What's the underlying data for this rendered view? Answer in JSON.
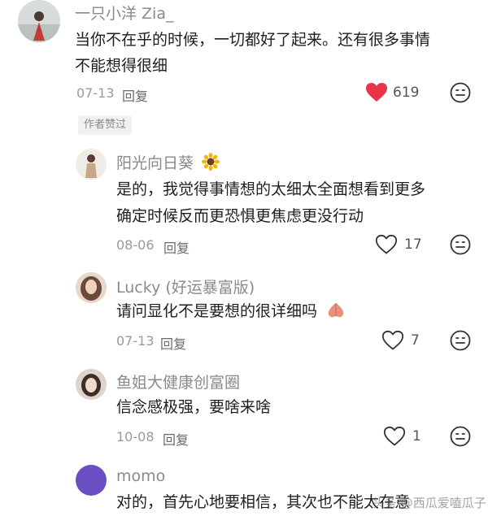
{
  "comments": [
    {
      "username": "一只小洋 Zia_",
      "text_lines": [
        "当你不在乎的时候，一切都好了起来。还有很多事情",
        "不能想得很细"
      ],
      "date": "07-13",
      "reply_label": "回复",
      "like_count": "619",
      "liked": true,
      "author_tag": "作者赞过"
    },
    {
      "username": "阳光向日葵",
      "text_lines": [
        "是的，我觉得事情想的太细太全面想看到更多",
        "确定时候反而更恐惧更焦虑更没行动"
      ],
      "date": "08-06",
      "reply_label": "回复",
      "like_count": "17",
      "liked": false
    },
    {
      "username": "Lucky (好运暴富版)",
      "text_lines": [
        "请问显化不是要想的很详细吗"
      ],
      "date": "07-13",
      "reply_label": "回复",
      "like_count": "7",
      "liked": false
    },
    {
      "username": "鱼姐大健康创富圈",
      "text_lines": [
        "信念感极强，要啥来啥"
      ],
      "date": "10-08",
      "reply_label": "回复",
      "like_count": "1",
      "liked": false
    },
    {
      "username": "momo",
      "text_lines": [
        "对的，首先心地要相信，其次也不能太在意"
      ],
      "date": "",
      "reply_label": "",
      "like_count": "",
      "liked": false
    }
  ],
  "watermark": "头条 @西瓜爱嗑瓜子",
  "colors": {
    "like_active": "#e8334a",
    "text_gray": "#8a8a8a",
    "avatar_purple": "#6a4fc4"
  },
  "icons": {
    "like_filled": "heart-filled-icon",
    "like_outline": "heart-outline-icon",
    "emoji": "emoji-face-icon"
  }
}
